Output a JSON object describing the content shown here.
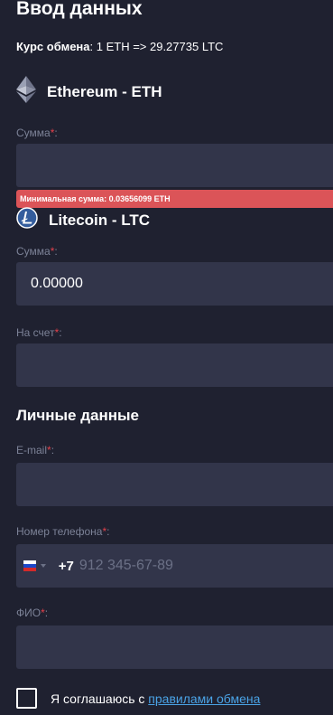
{
  "form": {
    "title": "Ввод данных",
    "rate_label": "Курс обмена",
    "rate_value": ": 1 ETH => 29.27735 LTC"
  },
  "from_coin": {
    "icon": "ethereum-icon",
    "name": "Ethereum - ETH",
    "amount_label": "Сумма",
    "amount_value": "",
    "error": "Минимальная сумма: 0.03656099 ETH"
  },
  "to_coin": {
    "icon": "litecoin-icon",
    "name": "Litecoin - LTC",
    "amount_label": "Сумма",
    "amount_value": "0.00000",
    "account_label": "На счет",
    "account_value": ""
  },
  "personal": {
    "title": "Личные данные",
    "email_label": "E-mail",
    "email_value": "",
    "phone_label": "Номер телефона",
    "phone_code": "+7",
    "phone_placeholder": "912 345-67-89",
    "phone_flag": "russia-flag-icon",
    "fio_label": "ФИО",
    "fio_value": ""
  },
  "agreement": {
    "text": "Я соглашаюсь с ",
    "link": "правилами обмена"
  },
  "required_mark": "*",
  "colon": ":",
  "colors": {
    "background": "#1f2130",
    "field": "#32354a",
    "label": "#7c8297",
    "required": "#e2414b",
    "error": "#db5458",
    "link": "#4aa3e6"
  }
}
